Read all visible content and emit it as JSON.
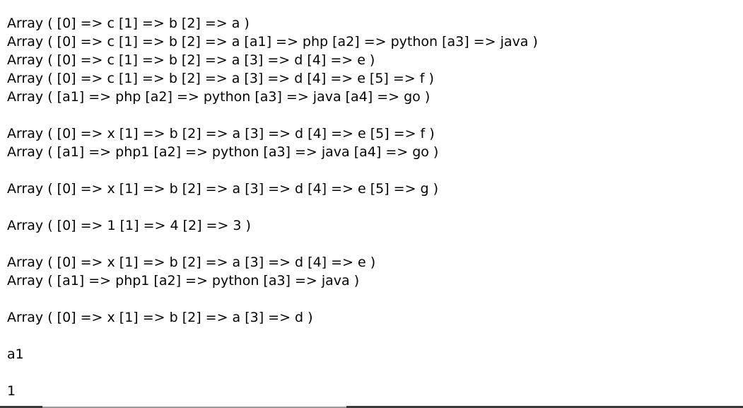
{
  "output": {
    "lines": [
      "Array ( [0] => c [1] => b [2] => a )",
      "Array ( [0] => c [1] => b [2] => a [a1] => php [a2] => python [a3] => java )",
      "Array ( [0] => c [1] => b [2] => a [3] => d [4] => e )",
      "Array ( [0] => c [1] => b [2] => a [3] => d [4] => e [5] => f )",
      "Array ( [a1] => php [a2] => python [a3] => java [a4] => go )",
      "",
      "Array ( [0] => x [1] => b [2] => a [3] => d [4] => e [5] => f )",
      "Array ( [a1] => php1 [a2] => python [a3] => java [a4] => go )",
      "",
      "Array ( [0] => x [1] => b [2] => a [3] => d [4] => e [5] => g )",
      "",
      "Array ( [0] => 1 [1] => 4 [2] => 3 )",
      "",
      "Array ( [0] => x [1] => b [2] => a [3] => d [4] => e )",
      "Array ( [a1] => php1 [a2] => python [a3] => java )",
      "",
      "Array ( [0] => x [1] => b [2] => a [3] => d )",
      "",
      "a1",
      "",
      "1"
    ]
  }
}
